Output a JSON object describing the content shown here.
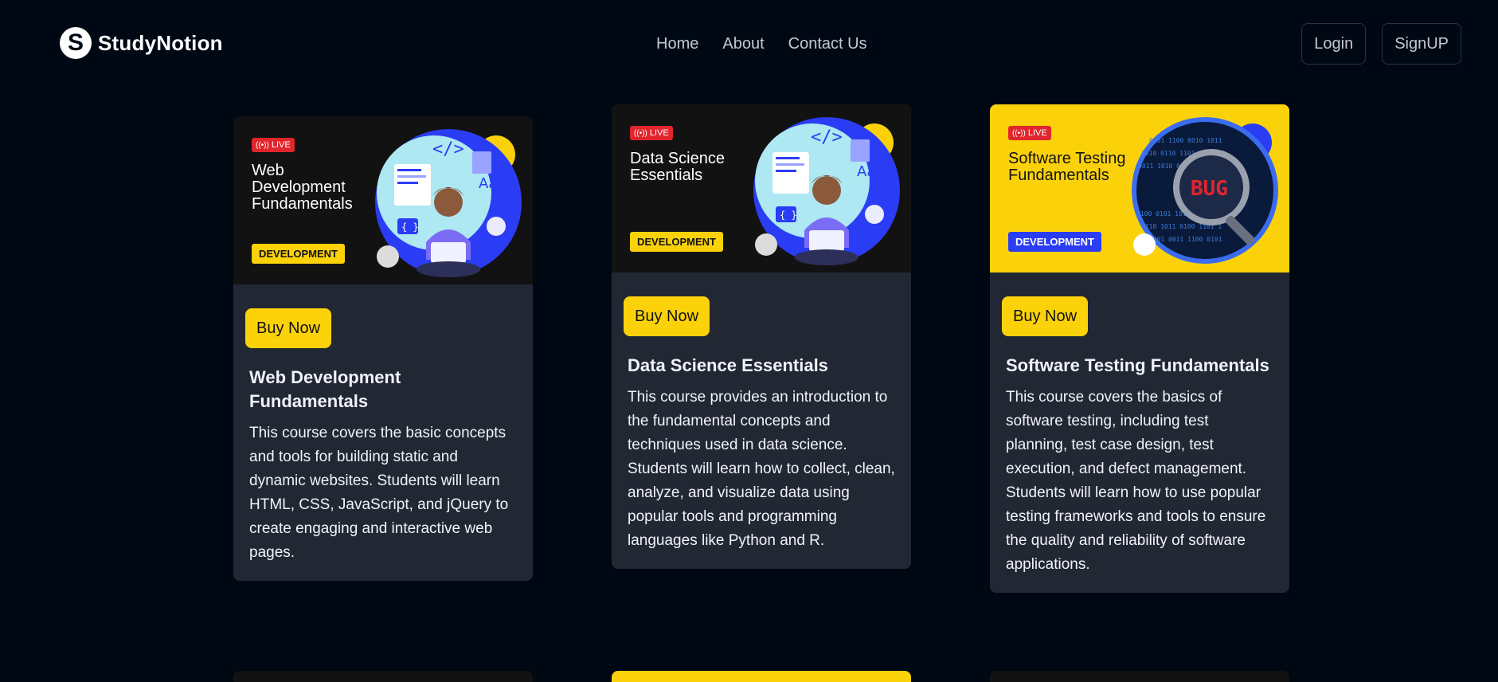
{
  "brand": {
    "name": "StudyNotion",
    "mark": "S"
  },
  "nav": {
    "links": [
      "Home",
      "About",
      "Contact Us"
    ],
    "login_label": "Login",
    "signup_label": "SignUP"
  },
  "courses": [
    {
      "thumb_live": "LIVE",
      "thumb_title": "Web Development Fundamentals",
      "thumb_badge": "DEVELOPMENT",
      "buy_label": "Buy Now",
      "title": "Web Development Fundamentals",
      "description": "This course covers the basic concepts and tools for building static and dynamic websites. Students will learn HTML, CSS, JavaScript, and jQuery to create engaging and interactive web pages."
    },
    {
      "thumb_live": "LIVE",
      "thumb_title": "Data Science Essentials",
      "thumb_badge": "DEVELOPMENT",
      "buy_label": "Buy Now",
      "title": "Data Science Essentials",
      "description": "This course provides an introduction to the fundamental concepts and techniques used in data science. Students will learn how to collect, clean, analyze, and visualize data using popular tools and programming languages like Python and R."
    },
    {
      "thumb_live": "LIVE",
      "thumb_title": "Software Testing Fundamentals",
      "thumb_badge": "DEVELOPMENT",
      "buy_label": "Buy Now",
      "title": "Software Testing Fundamentals",
      "description": "This course covers the basics of software testing, including test planning, test case design, test execution, and defect management. Students will learn how to use popular testing frameworks and tools to ensure the quality and reliability of software applications."
    }
  ],
  "colors": {
    "background": "#000814",
    "card": "#222833",
    "accent_yellow": "#fbd20a",
    "live_red": "#e0252c",
    "badge_blue": "#2b3df4"
  }
}
